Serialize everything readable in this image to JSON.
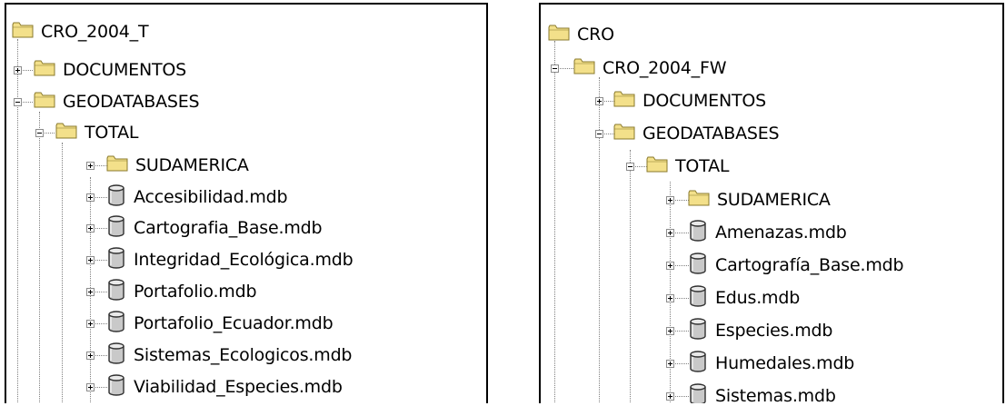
{
  "left_tree": {
    "items": [
      {
        "label": "CRO_2004_T",
        "icon": "folder-icon",
        "toggle": "none"
      },
      {
        "label": "DOCUMENTOS",
        "icon": "folder-icon",
        "toggle": "expand"
      },
      {
        "label": "GEODATABASES",
        "icon": "folder-icon",
        "toggle": "collapse"
      },
      {
        "label": "TOTAL",
        "icon": "folder-icon",
        "toggle": "collapse"
      },
      {
        "label": "SUDAMERICA",
        "icon": "folder-icon",
        "toggle": "expand"
      },
      {
        "label": "Accesibilidad.mdb",
        "icon": "database-icon",
        "toggle": "expand"
      },
      {
        "label": "Cartografia_Base.mdb",
        "icon": "database-icon",
        "toggle": "expand"
      },
      {
        "label": "Integridad_Ecológica.mdb",
        "icon": "database-icon",
        "toggle": "expand"
      },
      {
        "label": "Portafolio.mdb",
        "icon": "database-icon",
        "toggle": "expand"
      },
      {
        "label": "Portafolio_Ecuador.mdb",
        "icon": "database-icon",
        "toggle": "expand"
      },
      {
        "label": "Sistemas_Ecologicos.mdb",
        "icon": "database-icon",
        "toggle": "expand"
      },
      {
        "label": "Viabilidad_Especies.mdb",
        "icon": "database-icon",
        "toggle": "expand"
      }
    ]
  },
  "right_tree": {
    "items": [
      {
        "label": "CRO",
        "icon": "folder-icon",
        "toggle": "none"
      },
      {
        "label": "CRO_2004_FW",
        "icon": "folder-icon",
        "toggle": "collapse"
      },
      {
        "label": "DOCUMENTOS",
        "icon": "folder-icon",
        "toggle": "expand"
      },
      {
        "label": "GEODATABASES",
        "icon": "folder-icon",
        "toggle": "collapse"
      },
      {
        "label": "TOTAL",
        "icon": "folder-icon",
        "toggle": "collapse"
      },
      {
        "label": "SUDAMERICA",
        "icon": "folder-icon",
        "toggle": "expand"
      },
      {
        "label": "Amenazas.mdb",
        "icon": "database-icon",
        "toggle": "expand"
      },
      {
        "label": "Cartografía_Base.mdb",
        "icon": "database-icon",
        "toggle": "expand"
      },
      {
        "label": "Edus.mdb",
        "icon": "database-icon",
        "toggle": "expand"
      },
      {
        "label": "Especies.mdb",
        "icon": "database-icon",
        "toggle": "expand"
      },
      {
        "label": "Humedales.mdb",
        "icon": "database-icon",
        "toggle": "expand"
      },
      {
        "label": "Sistemas.mdb",
        "icon": "database-icon",
        "toggle": "expand"
      }
    ]
  },
  "colors": {
    "folder_fill": "#f3e08a",
    "folder_edge": "#8a7a2c",
    "db_fill": "#c9c9c9",
    "db_edge": "#303030",
    "tree_line": "#808080"
  }
}
